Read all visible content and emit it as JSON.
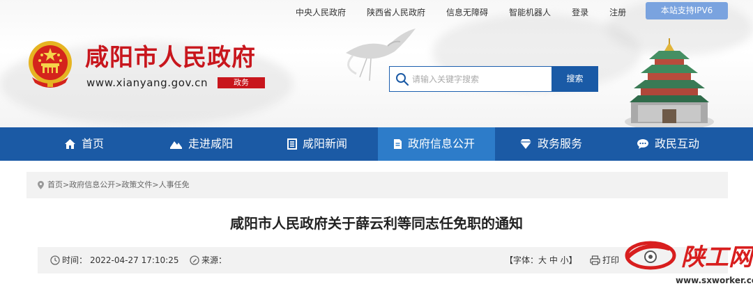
{
  "header": {
    "top_links": [
      "中央人民政府",
      "陕西省人民政府",
      "信息无障碍",
      "智能机器人",
      "登录",
      "注册"
    ],
    "ipv6_badge": "本站支持IPV6",
    "site_title": "咸阳市人民政府",
    "domain": "www.xianyang.gov.cn",
    "domain_tag": "政务",
    "search_placeholder": "请输入关键字搜索",
    "search_button": "搜索"
  },
  "nav": {
    "items": [
      {
        "label": "首页",
        "icon": "home-icon"
      },
      {
        "label": "走进咸阳",
        "icon": "mountain-icon"
      },
      {
        "label": "咸阳新闻",
        "icon": "news-icon"
      },
      {
        "label": "政府信息公开",
        "icon": "document-icon"
      },
      {
        "label": "政务服务",
        "icon": "diamond-icon"
      },
      {
        "label": "政民互动",
        "icon": "chat-icon"
      }
    ],
    "active_index": 3
  },
  "breadcrumb": "首页>政府信息公开>政策文件>人事任免",
  "article": {
    "title": "咸阳市人民政府关于薛云利等同志任免职的通知",
    "time_label": "时间：",
    "time_value": "2022-04-27 17:10:25",
    "source_label": "来源：",
    "font_size_label": "【字体：大 中 小】",
    "print_label": "打印"
  },
  "watermark": {
    "brand": "陕工网",
    "url": "www.sxworker.com"
  },
  "colors": {
    "brand_red": "#c8161d",
    "nav_blue": "#1b5aa5",
    "nav_active": "#2d7cc9",
    "ipv6_blue": "#7aa3df"
  }
}
